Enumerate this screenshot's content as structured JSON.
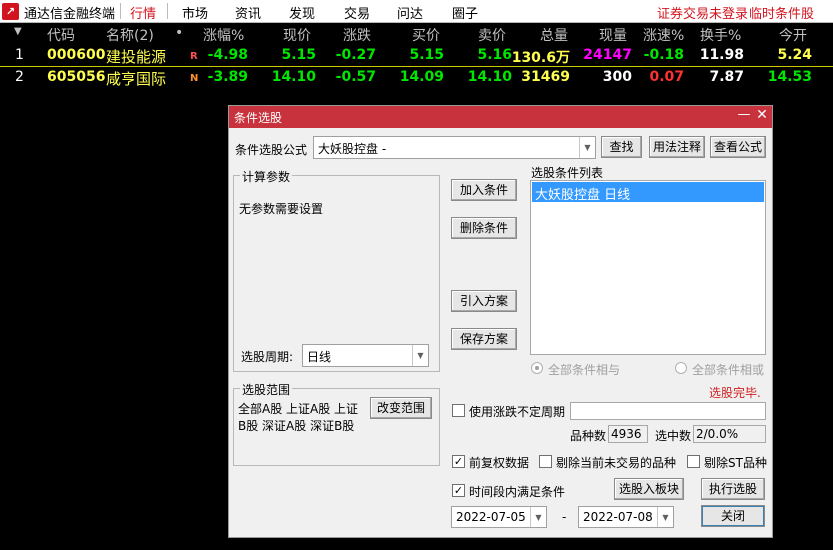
{
  "app": {
    "name": "通达信金融终端",
    "menu": [
      "行情",
      "市场",
      "资讯",
      "发现",
      "交易",
      "问达",
      "圈子"
    ],
    "status_login": "证券交易未登录",
    "status_temp": "临时条件股"
  },
  "quote_table": {
    "headers": [
      "代码",
      "名称(2)",
      "•",
      "涨幅%",
      "现价",
      "涨跌",
      "买价",
      "卖价",
      "总量",
      "现量",
      "涨速%",
      "换手%",
      "今开"
    ],
    "rows": [
      {
        "idx": "1",
        "code": "000600",
        "name": "建投能源",
        "flag": "R",
        "change_pct": "-4.98",
        "price": "5.15",
        "change": "-0.27",
        "bid": "5.15",
        "ask": "5.16",
        "volume": "130.6万",
        "cur_vol": "24147",
        "speed": "-0.18",
        "turnover": "11.98",
        "open": "5.24"
      },
      {
        "idx": "2",
        "code": "605056",
        "name": "咸亨国际",
        "flag": "N",
        "change_pct": "-3.89",
        "price": "14.10",
        "change": "-0.57",
        "bid": "14.09",
        "ask": "14.10",
        "volume": "31469",
        "cur_vol": "300",
        "speed": "0.07",
        "turnover": "7.87",
        "open": "14.53"
      }
    ]
  },
  "dialog": {
    "title": "条件选股",
    "formula_label": "条件选股公式",
    "formula_value": "大妖股控盘    -",
    "btn_find": "查找",
    "btn_usage": "用法注释",
    "btn_view": "查看公式",
    "params_label": "计算参数",
    "params_text": "无参数需要设置",
    "period_label": "选股周期:",
    "period_value": "日线",
    "btn_add": "加入条件",
    "btn_delete": "删除条件",
    "btn_import": "引入方案",
    "btn_save": "保存方案",
    "cond_list_label": "选股条件列表",
    "cond_items": [
      "大妖股控盘  日线"
    ],
    "radio_and": "全部条件相与",
    "radio_or": "全部条件相或",
    "status": "选股完毕.",
    "range_label": "选股范围",
    "range_text": "全部A股 上证A股 上证B股 深证A股 深证B股",
    "btn_change_range": "改变范围",
    "chk_uncertain": "使用涨跌不定周期",
    "count_label": "品种数",
    "count_value": "4936",
    "selected_label": "选中数",
    "selected_value": "2/0.0%",
    "chk_adjust": "前复权数据",
    "chk_exclude_nontrade": "剔除当前未交易的品种",
    "chk_exclude_st": "剔除ST品种",
    "chk_timerange": "时间段内满足条件",
    "btn_to_block": "选股入板块",
    "btn_execute": "执行选股",
    "date_from": "2022-07-05",
    "date_sep": "-",
    "date_to": "2022-07-08",
    "btn_close": "关闭"
  }
}
